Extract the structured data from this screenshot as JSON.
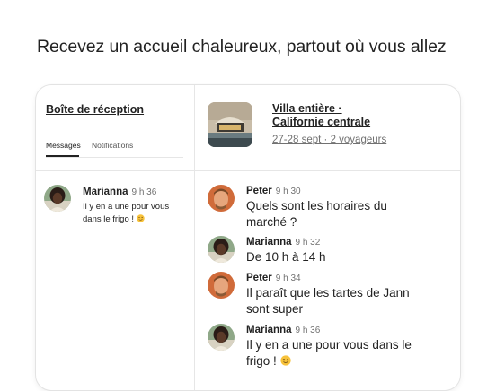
{
  "headline": "Recevez un accueil chaleureux, partout où vous allez",
  "inbox": {
    "title": "Boîte de réception",
    "tabs": [
      "Messages",
      "Notifications"
    ],
    "active_tab": "Messages",
    "conversation": {
      "name": "Marianna",
      "time": "9 h 36",
      "preview": "Il y en a une pour vous dans le frigo !"
    }
  },
  "listing": {
    "title_line1": "Villa entière ·",
    "title_line2": "Californie centrale",
    "dates": "27-28 sept · 2 voyageurs"
  },
  "messages": [
    {
      "sender": "Peter",
      "time": "9 h 30",
      "text": "Quels sont les horaires du marché ?"
    },
    {
      "sender": "Marianna",
      "time": "9 h 32",
      "text": "De 10 h à 14 h"
    },
    {
      "sender": "Peter",
      "time": "9 h 34",
      "text": "Il paraît que les tartes de Jann sont super"
    },
    {
      "sender": "Marianna",
      "time": "9 h 36",
      "text": "Il y en a une pour vous dans le frigo !"
    }
  ],
  "icons": {
    "wink_emoji": "wink-emoji-icon"
  }
}
